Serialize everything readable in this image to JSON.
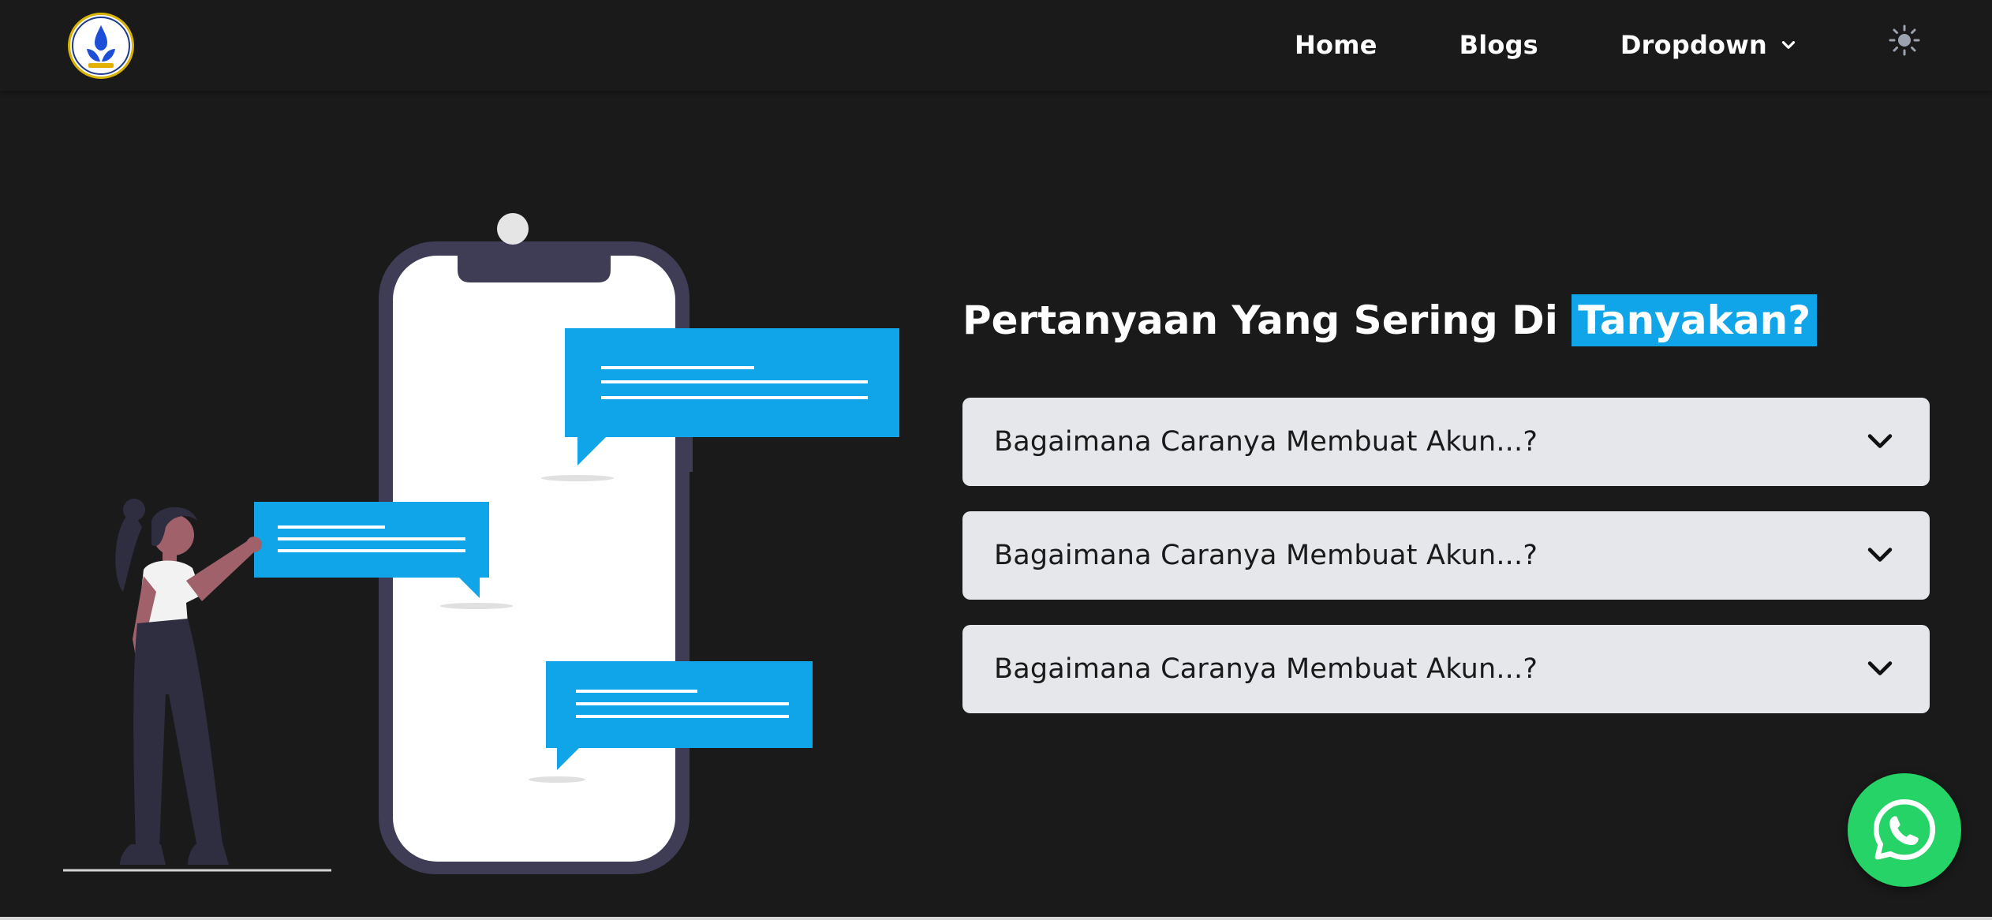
{
  "navbar": {
    "logo_icon": "university-logo",
    "links": [
      {
        "label": "Home"
      },
      {
        "label": "Blogs"
      },
      {
        "label": "Dropdown",
        "icon": "chevron-down-icon"
      }
    ],
    "theme_icon": "sun-icon"
  },
  "illustration": {
    "description_icon": "chat-phone-illustration"
  },
  "faq": {
    "title_prefix": "Pertanyaan Yang Sering Di",
    "title_highlight": "Tanyakan?",
    "items": [
      {
        "question": "Bagaimana Caranya Membuat Akun...?"
      },
      {
        "question": "Bagaimana Caranya Membuat Akun...?"
      },
      {
        "question": "Bagaimana Caranya Membuat Akun...?"
      }
    ]
  },
  "whatsapp": {
    "icon": "whatsapp-icon"
  },
  "colors": {
    "background": "#1a1a1a",
    "accent": "#10a5e9",
    "faq_item_bg": "#e5e7eb",
    "whatsapp": "#25d366",
    "phone_frame": "#3f3d56"
  }
}
